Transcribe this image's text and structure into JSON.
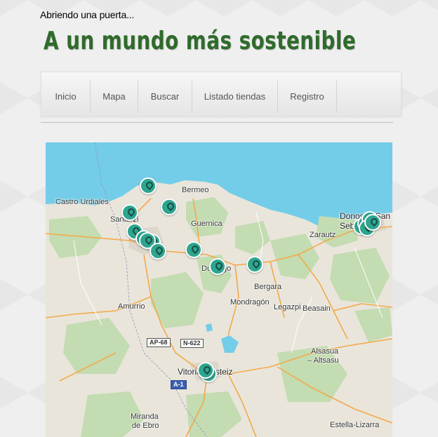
{
  "header": {
    "tagline": "Abriendo una puerta...",
    "title": "A un mundo más sostenible"
  },
  "nav": {
    "items": [
      {
        "label": "Inicio"
      },
      {
        "label": "Mapa"
      },
      {
        "label": "Buscar"
      },
      {
        "label": "Listado tiendas"
      },
      {
        "label": "Registro"
      }
    ]
  },
  "map": {
    "place_labels": [
      {
        "text": "Castro Urdiales"
      },
      {
        "text": "Bermeo"
      },
      {
        "text": "Santurzi"
      },
      {
        "text": "Guernica"
      },
      {
        "text": "Donostia San Sebastian"
      },
      {
        "text": "Zarautz"
      },
      {
        "text": "Durango"
      },
      {
        "text": "Bergara"
      },
      {
        "text": "Amurrio"
      },
      {
        "text": "Mondragón"
      },
      {
        "text": "Legazpi"
      },
      {
        "text": "Beasain"
      },
      {
        "text": "Alsasua"
      },
      {
        "text": "– Altsasu"
      },
      {
        "text": "Vitoria-Gasteiz"
      },
      {
        "text": "Miranda"
      },
      {
        "text": "de Ebro"
      },
      {
        "text": "Estella-Lizarra"
      }
    ],
    "road_shields": [
      {
        "text": "AP-68"
      },
      {
        "text": "N-622"
      },
      {
        "text": "A-1"
      }
    ],
    "marker_count": 20
  },
  "colors": {
    "title_green": "#2f6b2c",
    "sea": "#73cde8",
    "land": "#e9e5db",
    "forest": "#c3dcb1",
    "marker": "#2da58f"
  }
}
